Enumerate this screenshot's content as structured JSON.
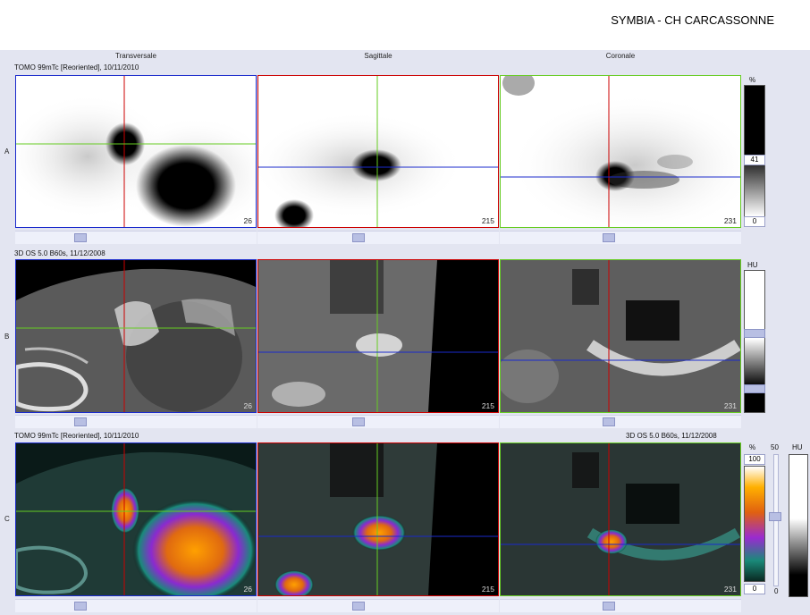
{
  "header": {
    "title": "SYMBIA - CH CARCASSONNE"
  },
  "columns": {
    "transversale": "Transversale",
    "sagittale": "Sagittale",
    "coronale": "Coronale"
  },
  "rows": {
    "a": {
      "letter": "A",
      "series": "TOMO 99mTc [Reoriented], 10/11/2010"
    },
    "b": {
      "letter": "B",
      "series": "3D  OS  5.0  B60s, 11/12/2008"
    },
    "c": {
      "letter": "C",
      "series_left": "TOMO 99mTc [Reoriented], 10/11/2010",
      "series_right": "3D  OS  5.0  B60s, 11/12/2008"
    }
  },
  "slices": {
    "transversale": "26",
    "sagittale": "215",
    "coronale": "231"
  },
  "scales": {
    "a": {
      "unit": "%",
      "value": "41",
      "min": "0"
    },
    "b": {
      "unit": "HU"
    },
    "c": {
      "pet_unit": "%",
      "pet_max": "100",
      "pet_min": "0",
      "blend_max": "50",
      "blend_min": "0",
      "ct_unit": "HU"
    }
  },
  "colors": {
    "crosshair_red": "#cc0000",
    "crosshair_green": "#66cc22",
    "crosshair_blue": "#1a2acc",
    "workspace": "#e3e5f1"
  },
  "icons": [
    "crosshair-icon",
    "slider-thumb-icon"
  ]
}
